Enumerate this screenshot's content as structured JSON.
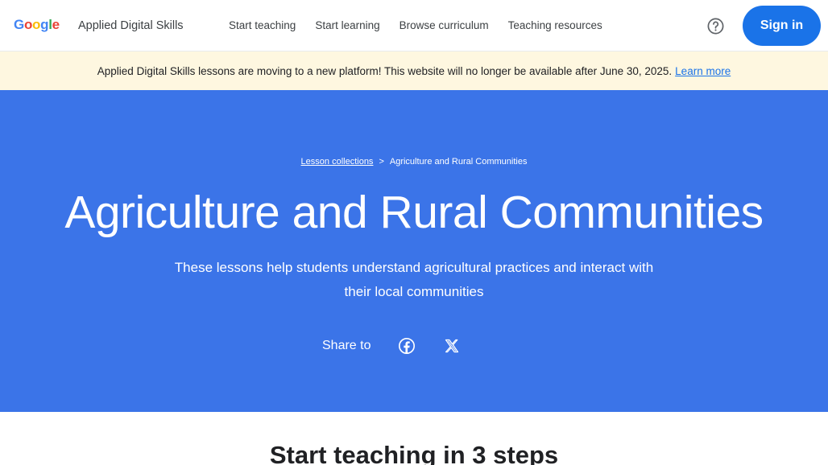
{
  "header": {
    "logo_letters": [
      "G",
      "o",
      "o",
      "g",
      "l",
      "e"
    ],
    "logo_colors": [
      "#4285F4",
      "#EA4335",
      "#FBBC05",
      "#4285F4",
      "#34A853",
      "#EA4335"
    ],
    "product_name": "Applied Digital Skills",
    "nav": [
      {
        "label": "Start teaching"
      },
      {
        "label": "Start learning"
      },
      {
        "label": "Browse curriculum"
      },
      {
        "label": "Teaching resources"
      }
    ],
    "help_icon": "help-circle-icon",
    "signin_label": "Sign in"
  },
  "banner": {
    "message": "Applied Digital Skills lessons are moving to a new platform! This website will no longer be available after June 30, 2025.",
    "link_label": "Learn more"
  },
  "hero": {
    "breadcrumb_link": "Lesson collections",
    "breadcrumb_separator": ">",
    "breadcrumb_current": "Agriculture and Rural Communities",
    "title": "Agriculture and Rural Communities",
    "subtitle": "These lessons help students understand agricultural practices and interact with their local communities",
    "share_label": "Share to",
    "share_icons": [
      "facebook-icon",
      "x-icon"
    ]
  },
  "steps": {
    "title": "Start teaching in 3 steps"
  },
  "colors": {
    "hero_bg": "#3b74e8",
    "accent": "#1a73e8",
    "banner_bg": "#fef7e0"
  }
}
